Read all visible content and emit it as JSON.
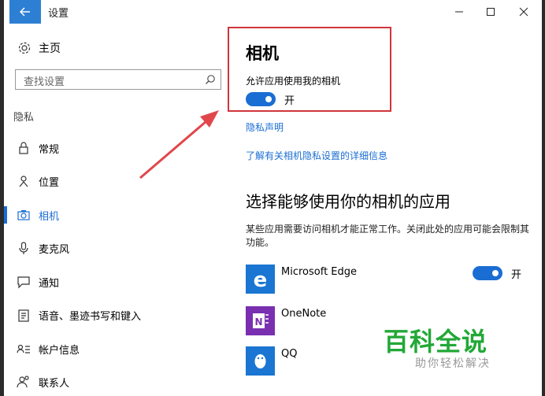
{
  "window": {
    "title": "设置"
  },
  "sidebar": {
    "home_label": "主页",
    "search_placeholder": "查找设置",
    "group_label": "隐私",
    "items": [
      {
        "label": "常规",
        "icon": "lock-icon",
        "active": false
      },
      {
        "label": "位置",
        "icon": "location-icon",
        "active": false
      },
      {
        "label": "相机",
        "icon": "camera-icon",
        "active": true
      },
      {
        "label": "麦克风",
        "icon": "microphone-icon",
        "active": false
      },
      {
        "label": "通知",
        "icon": "chat-bubble-icon",
        "active": false
      },
      {
        "label": "语音、墨迹书写和键入",
        "icon": "clipboard-icon",
        "active": false
      },
      {
        "label": "帐户信息",
        "icon": "account-list-icon",
        "active": false
      },
      {
        "label": "联系人",
        "icon": "contacts-icon",
        "active": false
      }
    ]
  },
  "main": {
    "title": "相机",
    "allow_label": "允许应用使用我的相机",
    "allow_toggle_state": "开",
    "privacy_link": "隐私声明",
    "learn_more_link": "了解有关相机隐私设置的详细信息",
    "section_title": "选择能够使用你的相机的应用",
    "section_desc": "某些应用需要访问相机才能正常工作。关闭此处的应用可能会限制其功能。",
    "apps": [
      {
        "name": "Microsoft Edge",
        "toggle_state": "开"
      },
      {
        "name": "OneNote",
        "toggle_state": ""
      },
      {
        "name": "QQ",
        "toggle_state": ""
      }
    ]
  },
  "watermark": {
    "logo": "百科全说",
    "sub": "助你轻松解决"
  },
  "colors": {
    "accent": "#1a6dd3",
    "highlight_box": "#d0353b",
    "watermark": "#22a837"
  }
}
